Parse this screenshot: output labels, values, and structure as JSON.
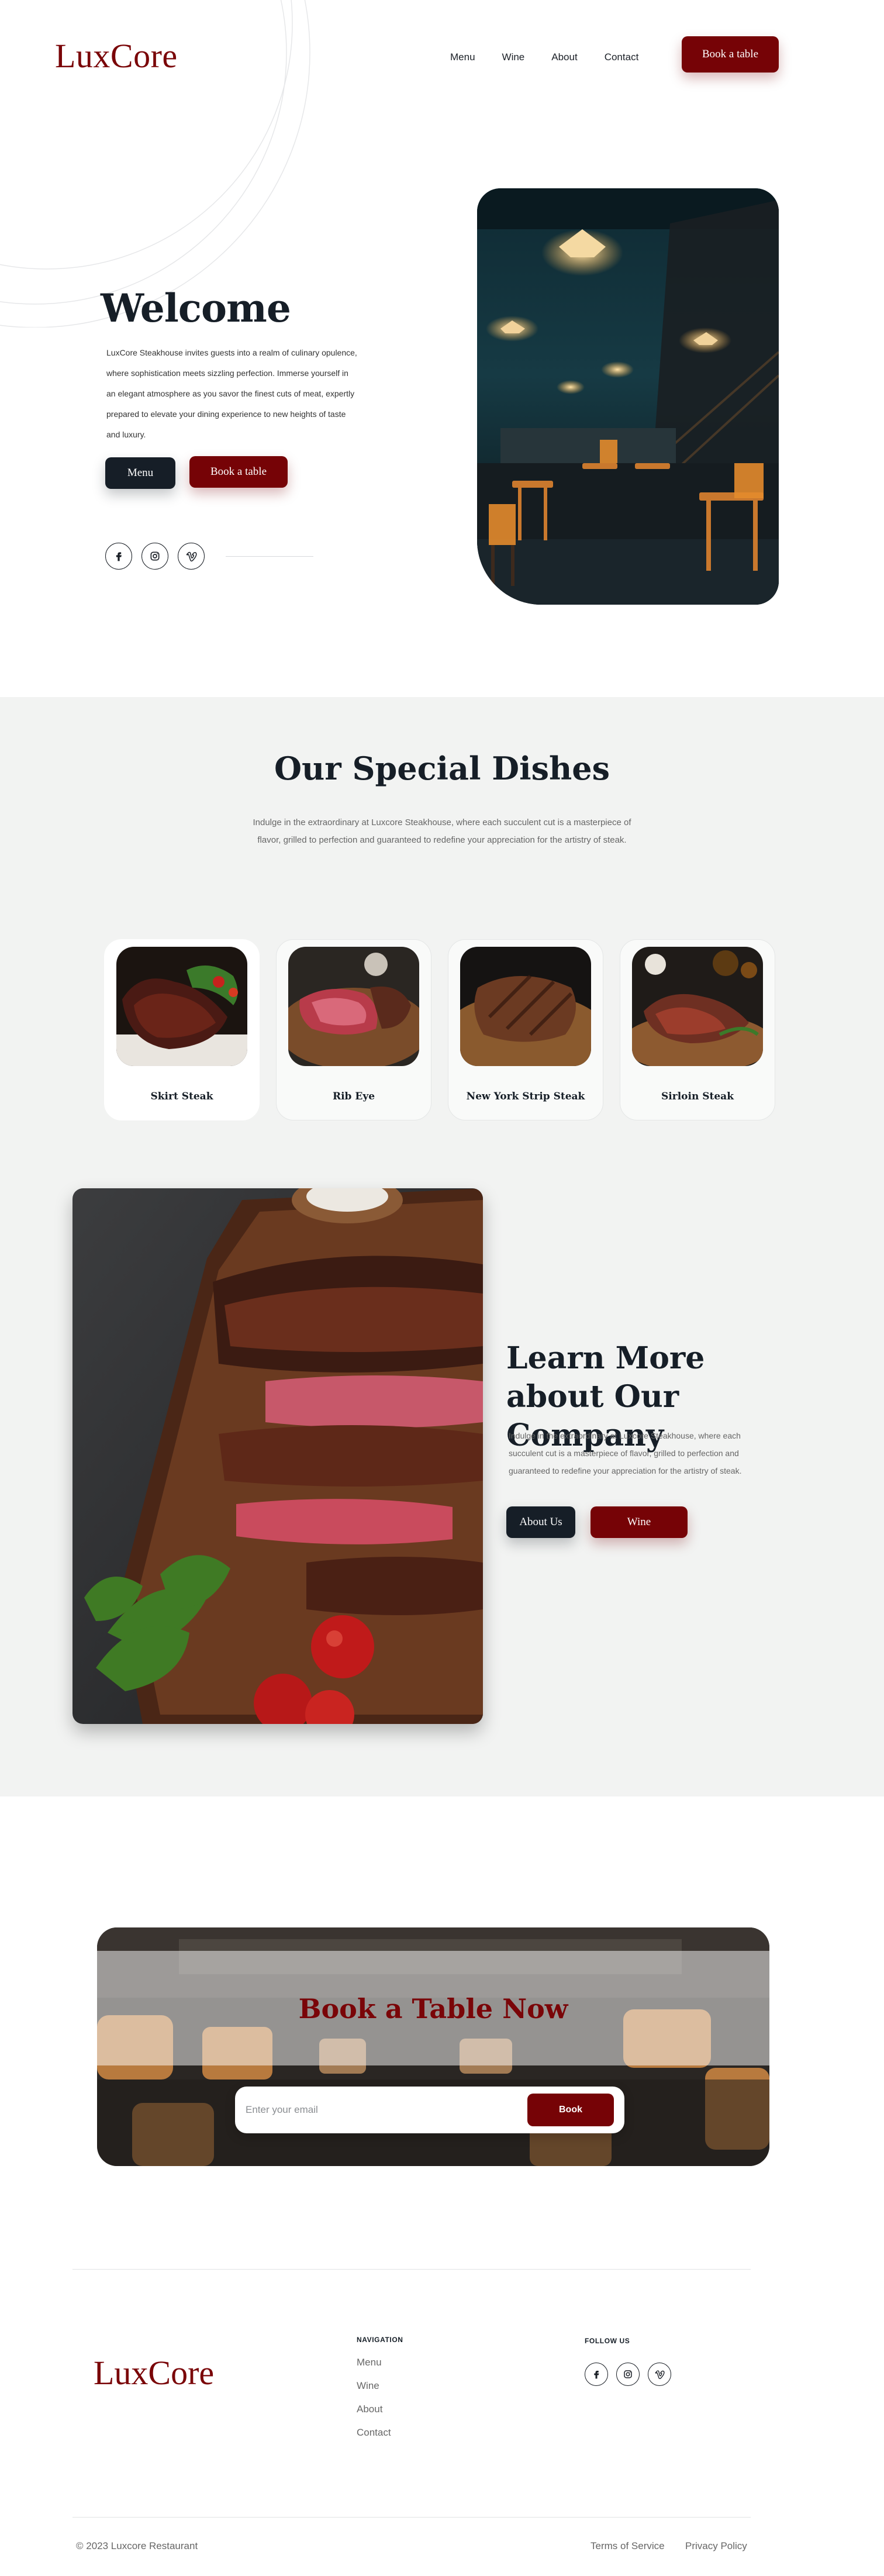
{
  "brand": {
    "logo": "LuxCore",
    "color": "#7a0508"
  },
  "header": {
    "nav": [
      "Menu",
      "Wine",
      "About",
      "Contact"
    ],
    "book_label": "Book a table"
  },
  "hero": {
    "title": "Welcome",
    "text": "LuxCore Steakhouse invites guests into a realm of culinary opulence, where sophistication meets sizzling perfection. Immerse yourself in an elegant atmosphere as you savor the finest cuts of meat, expertly prepared to elevate your dining experience to new heights of taste and luxury.",
    "menu_label": "Menu",
    "book_label": "Book a table",
    "social_icons": [
      "facebook-icon",
      "instagram-icon",
      "vimeo-icon"
    ]
  },
  "dishes": {
    "title": "Our Special Dishes",
    "description": "Indulge in the extraordinary at Luxcore Steakhouse, where each succulent cut is a masterpiece of flavor, grilled to perfection and guaranteed to redefine your appreciation for the artistry of steak.",
    "items": [
      {
        "name": "Skirt Steak"
      },
      {
        "name": "Rib Eye"
      },
      {
        "name": "New York Strip Steak"
      },
      {
        "name": "Sirloin Steak"
      }
    ]
  },
  "learn": {
    "title": "Learn More about Our Company",
    "text": "Indulge in the extraordinary at Luxcore Steakhouse, where each succulent cut is a masterpiece of flavor, grilled to perfection and guaranteed to redefine your appreciation for the artistry of steak.",
    "about_label": "About Us",
    "wine_label": "Wine"
  },
  "booking": {
    "title": "Book a Table Now",
    "placeholder": "Enter your email",
    "button_label": "Book"
  },
  "footer": {
    "logo": "LuxCore",
    "nav_heading": "NAVIGATION",
    "nav": [
      "Menu",
      "Wine",
      "About",
      "Contact"
    ],
    "follow_heading": "FOLLOW US",
    "copyright": "2023 Luxcore Restaurant",
    "copyright_symbol": "©",
    "terms": "Terms of Service",
    "privacy": "Privacy Policy"
  },
  "colors": {
    "accent_red": "#760306",
    "dark": "#161e27",
    "section_bg": "#f2f3f2"
  }
}
